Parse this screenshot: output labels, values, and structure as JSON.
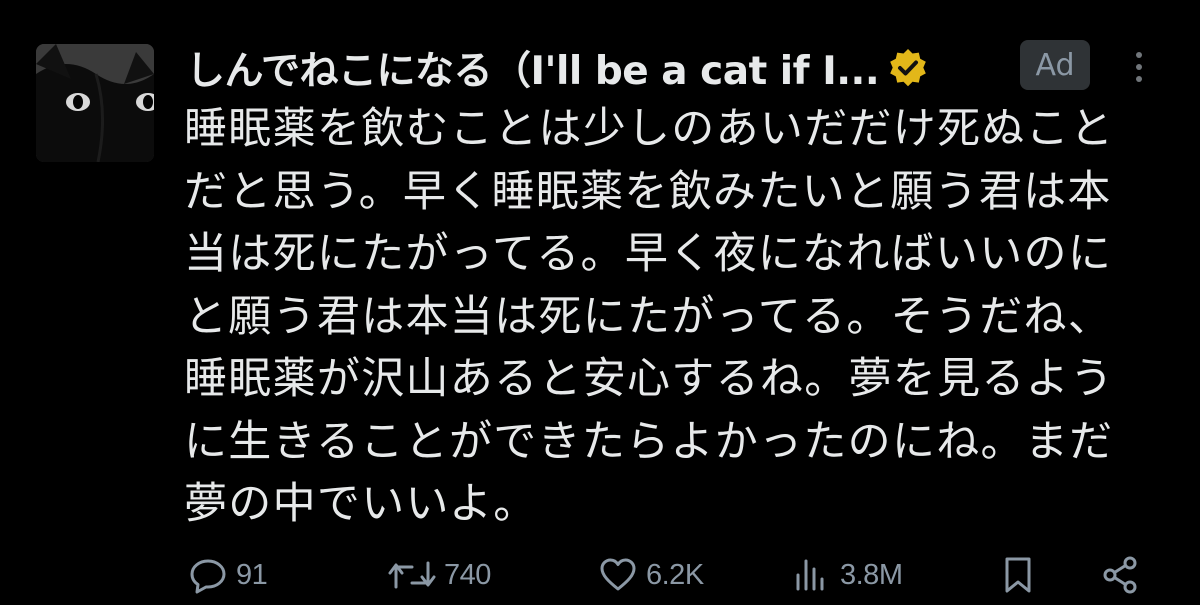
{
  "post": {
    "display_name": "しんでねこになる（I'll be a cat if I...",
    "ad_label": "Ad",
    "body_lines": [
      "睡眠薬を飲むことは少しのあいだだけ死ぬこと",
      "だと思う。早く睡眠薬を飲みたいと願う君は本",
      "当は死にたがってる。早く夜になればいいのに",
      "と願う君は本当は死にたがってる。そうだね、",
      "睡眠薬が沢山あると安心するね。夢を見るよう",
      "に生きることができたらよかったのにね。まだ",
      "夢の中でいいよ。"
    ]
  },
  "actions": {
    "reply": {
      "icon": "reply-icon",
      "count": "91"
    },
    "repost": {
      "icon": "repost-icon",
      "count": "740"
    },
    "like": {
      "icon": "heart-icon",
      "count": "6.2K"
    },
    "views": {
      "icon": "views-icon",
      "count": "3.8M"
    },
    "bookmark": {
      "icon": "bookmark-icon"
    },
    "share": {
      "icon": "share-icon"
    }
  },
  "colors": {
    "background": "#000000",
    "text": "#e7e9ea",
    "muted": "#71767b",
    "verified_gold": "#e2b719",
    "ad_badge_bg": "#2f3336"
  }
}
